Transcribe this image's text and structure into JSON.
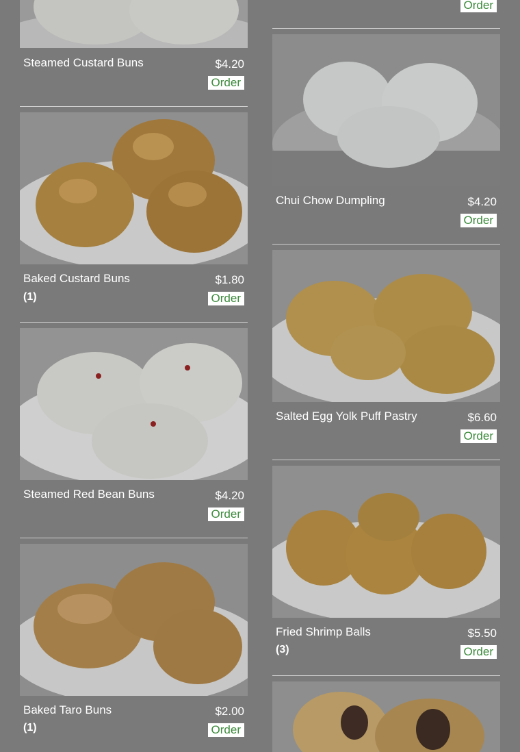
{
  "menu": {
    "order_label": "Order",
    "left": [
      {
        "name": "Steamed Custard Buns",
        "sub": "",
        "price": "$4.20",
        "dish": "white-steamed-buns"
      },
      {
        "name": "Baked Custard Buns",
        "sub": "(1)",
        "price": "$1.80",
        "dish": "golden-sesame-buns"
      },
      {
        "name": "Steamed Red Bean Buns",
        "sub": "",
        "price": "$4.20",
        "dish": "white-buns-red-dot"
      },
      {
        "name": "Baked Taro Buns",
        "sub": "(1)",
        "price": "$2.00",
        "dish": "golden-crust-buns"
      }
    ],
    "right": [
      {
        "name": "",
        "sub": "",
        "price": "",
        "dish": "partial-top"
      },
      {
        "name": "Chui Chow Dumpling",
        "sub": "",
        "price": "$4.20",
        "dish": "translucent-dumplings"
      },
      {
        "name": "Salted Egg Yolk Puff Pastry",
        "sub": "",
        "price": "$6.60",
        "dish": "flaky-puff-pastry"
      },
      {
        "name": "Fried Shrimp Balls",
        "sub": "(3)",
        "price": "$5.50",
        "dish": "fried-shrimp-balls"
      },
      {
        "name": "",
        "sub": "",
        "price": "",
        "dish": "fried-dumplings-partial"
      }
    ]
  }
}
